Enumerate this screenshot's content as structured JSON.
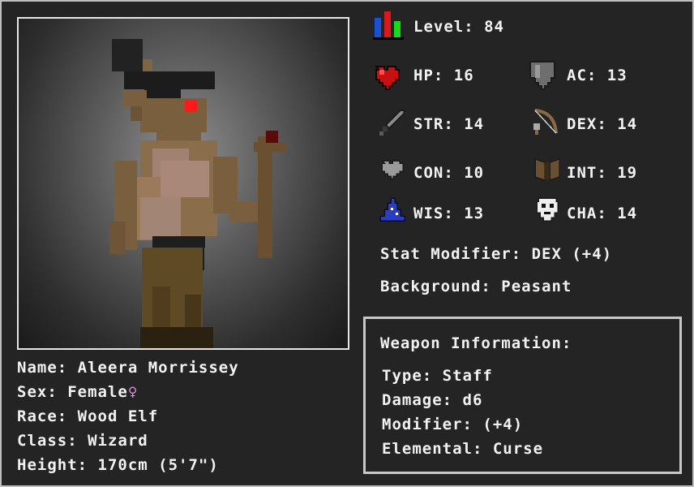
{
  "character": {
    "name_line": "Name: Aleera Morrissey",
    "sex_line": "Sex: Female",
    "sex_symbol": "♀",
    "race_line": "Race: Wood Elf",
    "class_line": "Class: Wizard",
    "height_line": "Height: 170cm (5'7\")"
  },
  "stats": {
    "level": "Level: 84",
    "hp": "HP: 16",
    "ac": "AC: 13",
    "str": "STR: 14",
    "dex": "DEX: 14",
    "con": "CON: 10",
    "int": "INT: 19",
    "wis": "WIS: 13",
    "cha": "CHA: 14",
    "stat_modifier": "Stat Modifier: DEX (+4)",
    "background": "Background: Peasant"
  },
  "weapon": {
    "header": "Weapon Information:",
    "type": "Type: Staff",
    "damage": "Damage: d6",
    "modifier": "Modifier: (+4)",
    "elemental": "Elemental: Curse"
  },
  "icons": {
    "level": "level-bars-icon",
    "hp": "heart-icon",
    "ac": "shield-icon",
    "str": "sword-icon",
    "dex": "bow-icon",
    "con": "grey-heart-icon",
    "int": "book-icon",
    "wis": "wizard-hat-icon",
    "cha": "mask-icon"
  },
  "colors": {
    "background": "#232323",
    "text": "#f2f2f2",
    "border": "#c8c8c8",
    "sex_symbol": "#e58ce0",
    "hp_red": "#c81010",
    "eye_red": "#ff1a1a"
  }
}
